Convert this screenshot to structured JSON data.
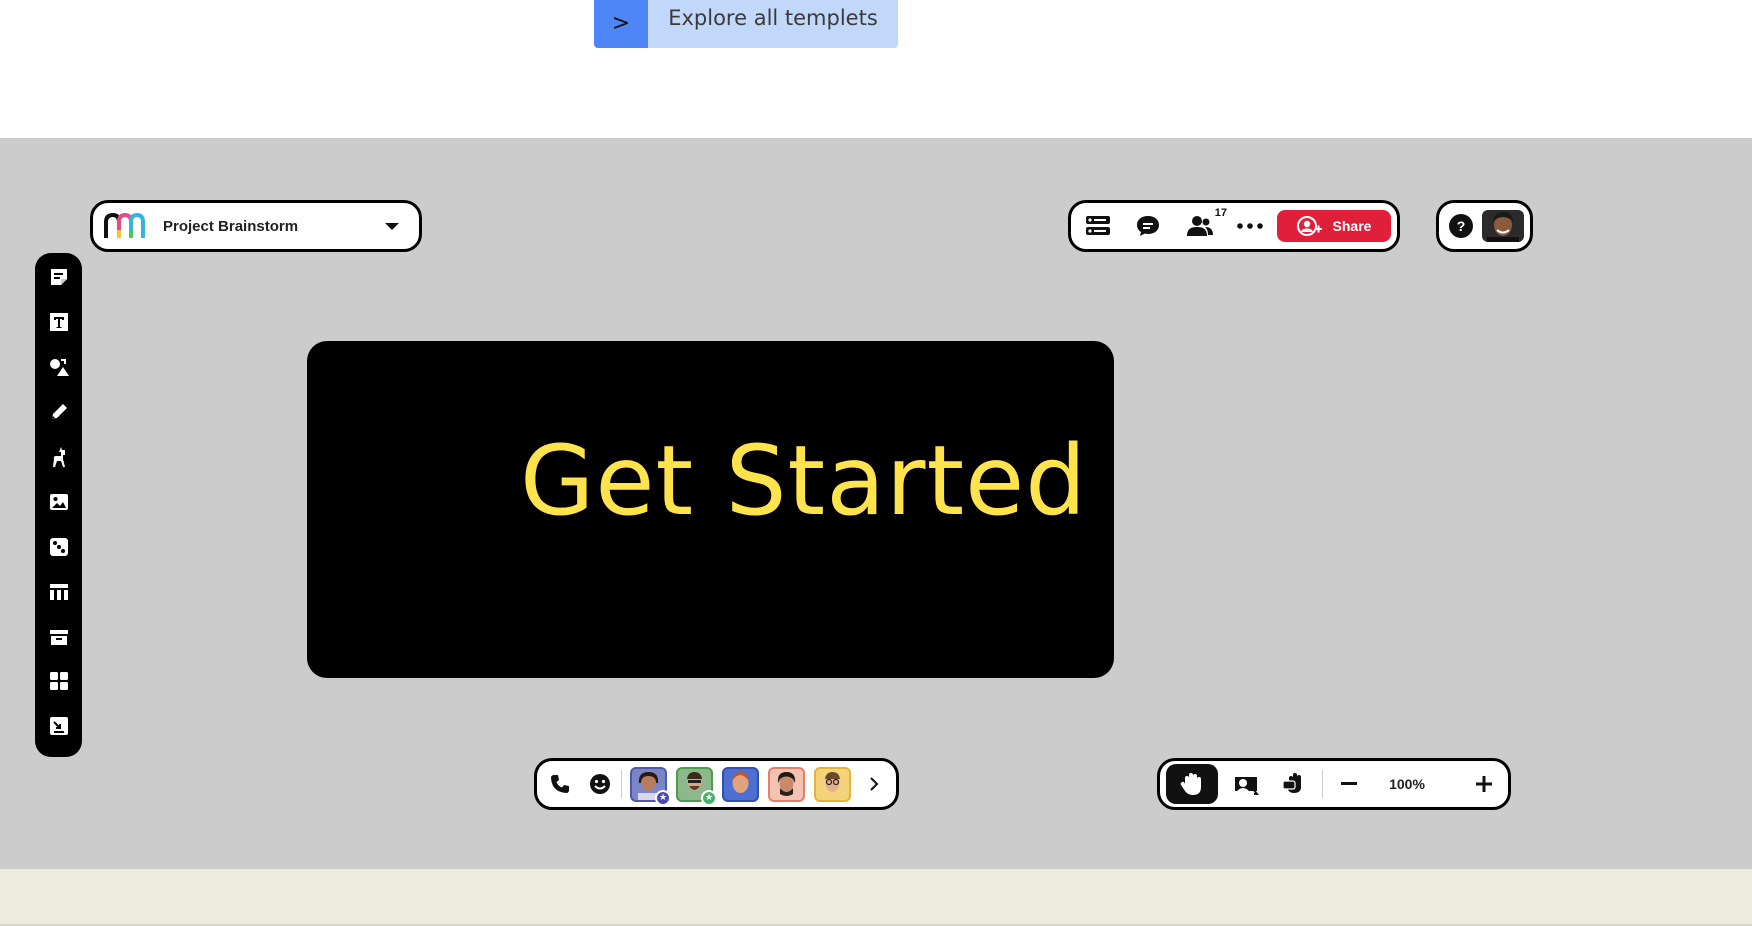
{
  "explore": {
    "arrow": ">",
    "label": "Explore all templets"
  },
  "board": {
    "name": "Project Brainstorm"
  },
  "collab": {
    "participant_count": "17",
    "share_label": "Share"
  },
  "help": {
    "label": "?"
  },
  "toolbar": {
    "tools": [
      "sticky-note",
      "text",
      "shapes",
      "pen",
      "llama",
      "image",
      "dice",
      "table",
      "archive",
      "grid",
      "import"
    ]
  },
  "hero": {
    "title": "Get Started"
  },
  "zoom": {
    "level": "100%"
  },
  "colors": {
    "accent_blue": "#4f86f7",
    "explore_bg": "#c1d8fb",
    "share_red": "#e0203a",
    "hero_text": "#ffe34d",
    "canvas_bg": "#cccccc",
    "footer_bg": "#ebecdd"
  }
}
